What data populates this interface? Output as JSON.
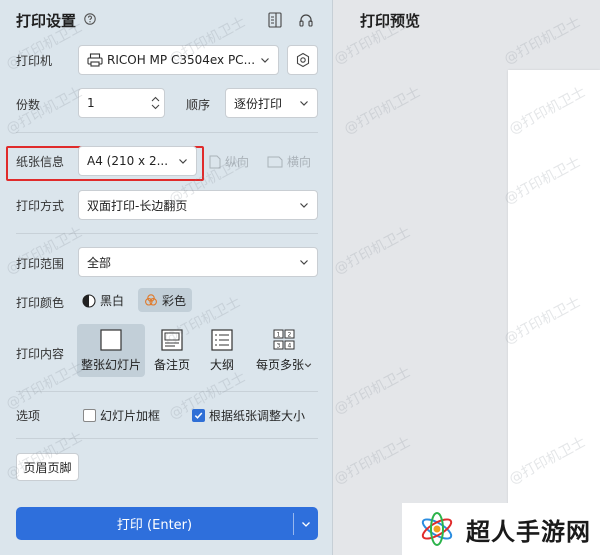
{
  "settings": {
    "title": "打印设置",
    "printer_label": "打印机",
    "printer_value": "RICOH MP C3504ex PC...",
    "copies_label": "份数",
    "copies_value": "1",
    "order_label": "顺序",
    "order_value": "逐份打印",
    "paper_label": "纸张信息",
    "paper_value": "A4 (210 x 2...",
    "portrait_label": "纵向",
    "landscape_label": "横向",
    "mode_label": "打印方式",
    "mode_value": "双面打印-长边翻页",
    "range_label": "打印范围",
    "range_value": "全部",
    "color_label": "打印颜色",
    "color_bw": "黑白",
    "color_color": "彩色",
    "content_label": "打印内容",
    "content_items": [
      "整张幻灯片",
      "备注页",
      "大纲",
      "每页多张"
    ],
    "options_label": "选项",
    "option_frame": "幻灯片加框",
    "option_fit": "根据纸张调整大小",
    "header_footer": "页眉页脚",
    "print_button": "打印 (Enter)"
  },
  "preview": {
    "title": "打印预览"
  },
  "watermark": "@打印机卫士",
  "logo": {
    "text": "超人手游网"
  },
  "colors": {
    "accent": "#2e6fdc",
    "highlight": "#e02b2b"
  }
}
